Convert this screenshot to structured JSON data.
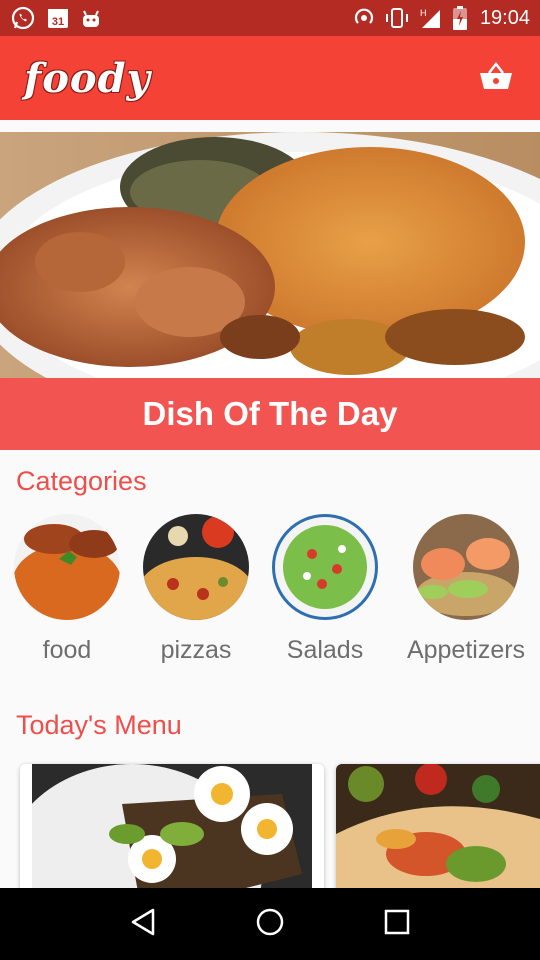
{
  "status_bar": {
    "time": "19:04",
    "calendar_day": "31",
    "icons": [
      "whatsapp-icon",
      "calendar-icon",
      "android-icon",
      "hotspot-icon",
      "vibrate-icon",
      "signal-icon",
      "battery-charging-icon"
    ]
  },
  "app_bar": {
    "logo_text": "foody",
    "cart_icon": "shopping-basket-icon",
    "color": "#f44336"
  },
  "hero": {
    "title": "Dish Of The Day",
    "banner_color": "#f25551"
  },
  "categories": {
    "title": "Categories",
    "items": [
      {
        "label": "food"
      },
      {
        "label": "pizzas"
      },
      {
        "label": "Salads"
      },
      {
        "label": "Appetizers"
      }
    ]
  },
  "menu": {
    "title": "Today's Menu"
  },
  "nav_bar": {
    "icons": [
      "back-icon",
      "home-icon",
      "recents-icon"
    ]
  },
  "colors": {
    "accent": "#ef4f4b",
    "status_bar": "#b32b22"
  }
}
